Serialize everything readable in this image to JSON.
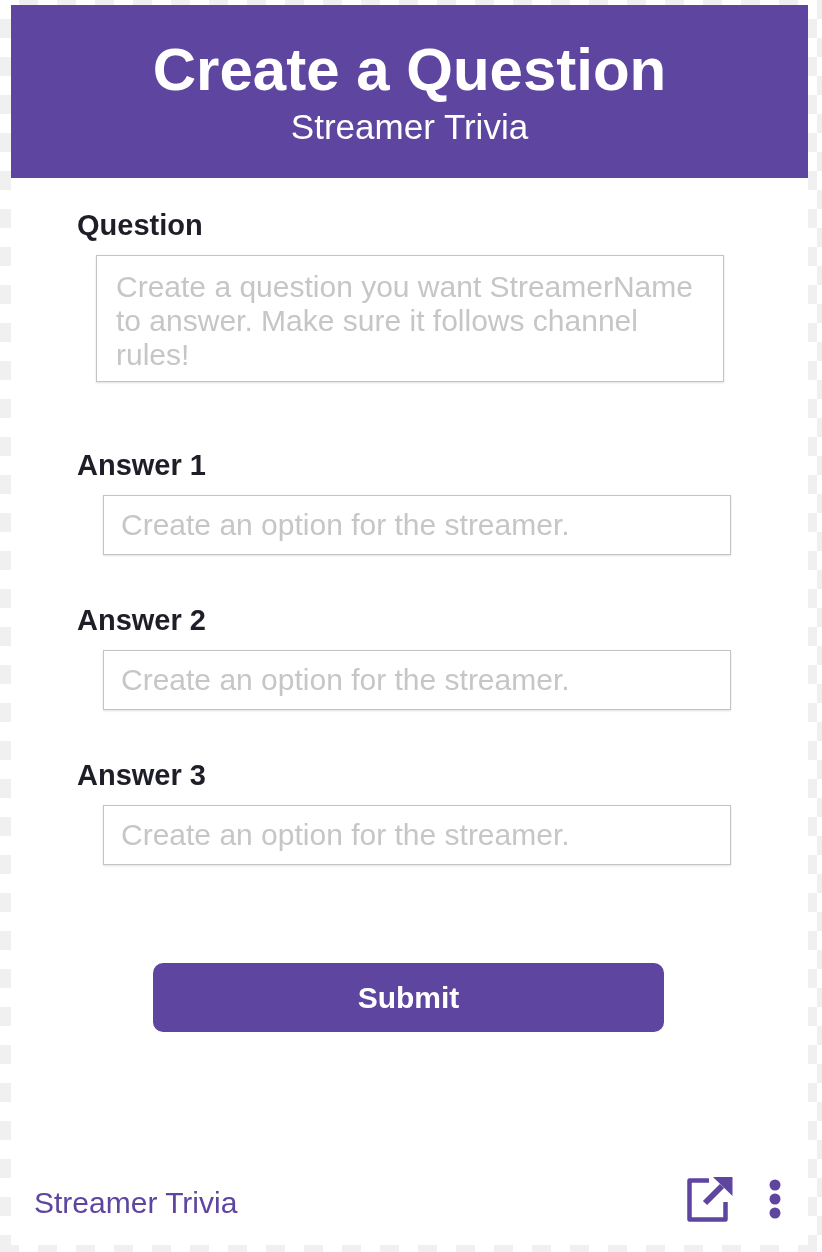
{
  "header": {
    "title": "Create a Question",
    "subtitle": "Streamer Trivia"
  },
  "fields": [
    {
      "kind": "textarea",
      "label": "Question",
      "placeholder": "Create a question you want StreamerName to answer. Make sure it follows channel rules!"
    },
    {
      "kind": "input",
      "label": "Answer 1",
      "placeholder": "Create an option for the streamer."
    },
    {
      "kind": "input",
      "label": "Answer 2",
      "placeholder": "Create an option for the streamer."
    },
    {
      "kind": "input",
      "label": "Answer 3",
      "placeholder": "Create an option for the streamer."
    }
  ],
  "submit": {
    "label": "Submit"
  },
  "footer": {
    "link": "Streamer Trivia"
  }
}
